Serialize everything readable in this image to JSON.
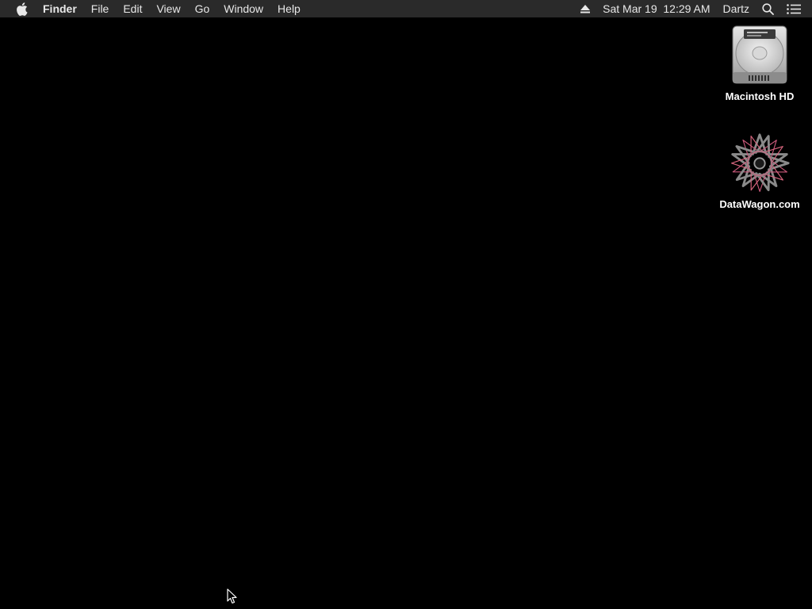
{
  "menubar": {
    "apple_icon": "apple-logo-icon",
    "app_name": "Finder",
    "menus": [
      "File",
      "Edit",
      "View",
      "Go",
      "Window",
      "Help"
    ],
    "status": {
      "eject_icon": "eject-icon",
      "clock": "Sat Mar 19  12:29 AM",
      "user": "Dartz",
      "spotlight_icon": "search-icon",
      "notifications_icon": "list-icon"
    }
  },
  "desktop": {
    "background": "#000000",
    "icons": [
      {
        "label": "Macintosh HD",
        "icon": "hard-drive-icon"
      },
      {
        "label": "DataWagon.com",
        "icon": "star-volume-icon"
      }
    ]
  },
  "cursor_icon": "arrow-cursor-icon"
}
